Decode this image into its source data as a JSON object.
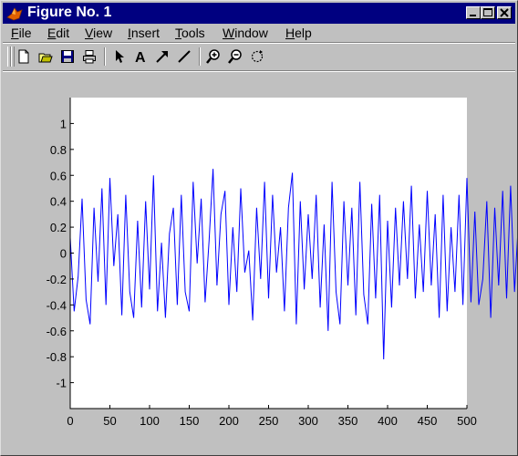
{
  "window": {
    "title": "Figure No. 1",
    "buttons": [
      "minimize",
      "maximize",
      "close"
    ]
  },
  "menu": [
    {
      "label": "File",
      "underline": "F",
      "rest": "ile"
    },
    {
      "label": "Edit",
      "underline": "E",
      "rest": "dit"
    },
    {
      "label": "View",
      "underline": "V",
      "rest": "iew"
    },
    {
      "label": "Insert",
      "underline": "I",
      "rest": "nsert"
    },
    {
      "label": "Tools",
      "underline": "T",
      "rest": "ools"
    },
    {
      "label": "Window",
      "underline": "W",
      "rest": "indow"
    },
    {
      "label": "Help",
      "underline": "H",
      "rest": "elp"
    }
  ],
  "toolbar": {
    "tools": [
      "new-file-icon",
      "open-folder-icon",
      "save-icon",
      "print-icon",
      "select-arrow-icon",
      "insert-text-icon",
      "insert-arrow-icon",
      "insert-line-icon",
      "zoom-in-icon",
      "zoom-out-icon",
      "rotate-3d-icon"
    ],
    "insert_text_glyph": "A"
  },
  "colors": {
    "title_bar": "#000080",
    "window_bg": "#c0c0c0",
    "axes_bg": "#ffffff",
    "line": "#0000ff"
  },
  "chart_data": {
    "type": "line",
    "title": "",
    "xlabel": "",
    "ylabel": "",
    "xlim": [
      0,
      500
    ],
    "ylim": [
      -1.2,
      1.2
    ],
    "xticks": [
      0,
      50,
      100,
      150,
      200,
      250,
      300,
      350,
      400,
      450,
      500
    ],
    "yticks": [
      -1,
      -0.8,
      -0.6,
      -0.4,
      -0.2,
      0,
      0.2,
      0.4,
      0.6,
      0.8,
      1
    ],
    "xtick_labels": [
      "0",
      "50",
      "100",
      "150",
      "200",
      "250",
      "300",
      "350",
      "400",
      "450",
      "500"
    ],
    "ytick_labels": [
      "-1",
      "-0.8",
      "-0.6",
      "-0.4",
      "-0.2",
      "0",
      "0.2",
      "0.4",
      "0.6",
      "0.8",
      "1"
    ],
    "grid": false,
    "series": [
      {
        "x_start": 0,
        "x_step": 5,
        "values": [
          0.12,
          -0.45,
          -0.18,
          0.42,
          -0.36,
          -0.55,
          0.35,
          -0.22,
          0.5,
          -0.4,
          0.58,
          -0.1,
          0.3,
          -0.48,
          0.45,
          -0.3,
          -0.5,
          0.25,
          -0.42,
          0.4,
          -0.28,
          0.6,
          -0.45,
          0.08,
          -0.5,
          0.15,
          0.35,
          -0.4,
          0.45,
          -0.3,
          -0.45,
          0.55,
          -0.08,
          0.42,
          -0.38,
          0.1,
          0.65,
          -0.25,
          0.3,
          0.48,
          -0.4,
          0.2,
          -0.3,
          0.5,
          -0.15,
          0.02,
          -0.52,
          0.35,
          -0.2,
          0.55,
          -0.35,
          0.45,
          -0.15,
          0.2,
          -0.45,
          0.35,
          0.62,
          -0.55,
          0.4,
          -0.28,
          0.3,
          -0.2,
          0.45,
          -0.42,
          0.22,
          -0.6,
          0.55,
          -0.3,
          -0.55,
          0.4,
          -0.25,
          0.35,
          -0.48,
          0.55,
          -0.32,
          -0.55,
          0.38,
          -0.35,
          0.45,
          -0.82,
          0.25,
          -0.42,
          0.35,
          -0.25,
          0.4,
          -0.2,
          0.52,
          -0.35,
          0.22,
          -0.3,
          0.48,
          -0.25,
          0.3,
          -0.5,
          0.45,
          -0.45,
          0.2,
          -0.3,
          0.45,
          -0.4,
          0.58,
          -0.38,
          0.32,
          -0.4,
          -0.2,
          0.4,
          -0.5,
          0.35,
          -0.25,
          0.48,
          -0.35,
          0.52,
          -0.3,
          0.25,
          -0.48,
          0.4,
          -0.18,
          0.4,
          0.52,
          -0.35,
          0.25,
          -0.2,
          0.55,
          0.42,
          0.3,
          -0.32,
          0.45,
          0.18,
          0.38,
          -0.15
        ]
      }
    ]
  }
}
